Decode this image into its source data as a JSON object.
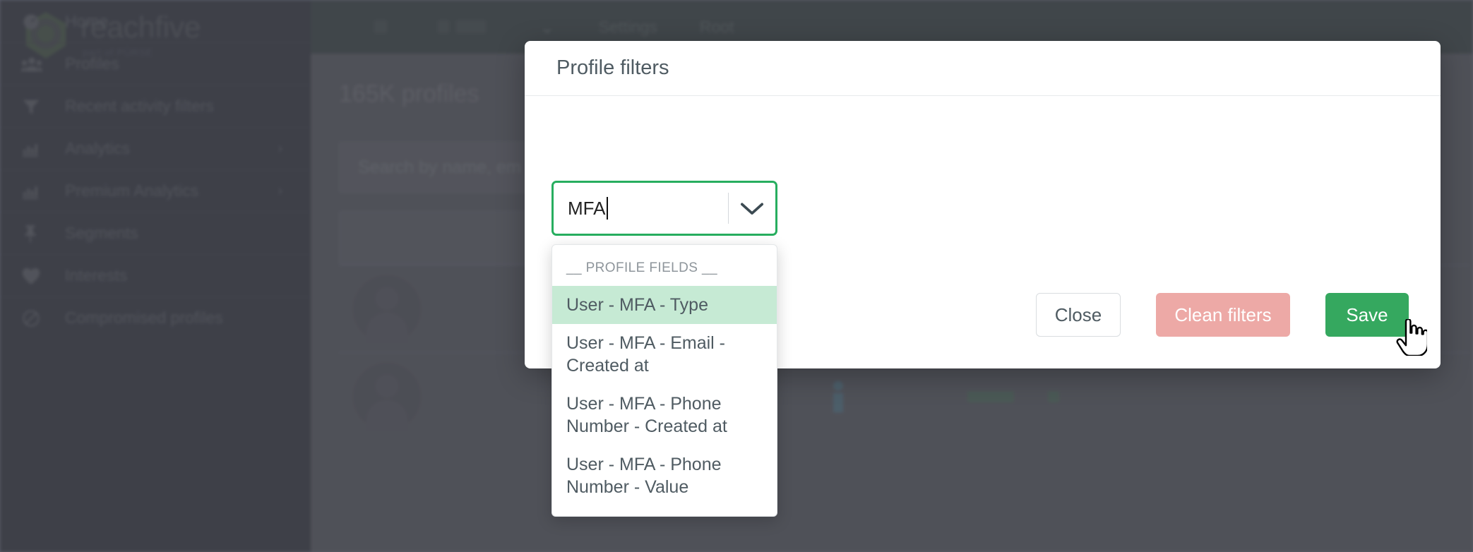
{
  "sidebar": {
    "brand": {
      "name": "reachfive",
      "tagline": "part of PÜRSE",
      "logo_icon": "hexagon-ring-logo"
    },
    "items": [
      {
        "label": "Home",
        "icon": "gauge-icon",
        "has_chevron": false
      },
      {
        "label": "Profiles",
        "icon": "people-icon",
        "has_chevron": false
      },
      {
        "label": "Recent activity filters",
        "icon": "funnel-icon",
        "has_chevron": false
      },
      {
        "label": "Analytics",
        "icon": "bar-chart-icon",
        "has_chevron": true,
        "chevron": "›"
      },
      {
        "label": "Premium Analytics",
        "icon": "bar-chart-icon",
        "has_chevron": true,
        "chevron": "›"
      },
      {
        "label": "Segments",
        "icon": "pin-icon",
        "has_chevron": false
      },
      {
        "label": "Interests",
        "icon": "heart-icon",
        "has_chevron": false
      },
      {
        "label": "Compromised profiles",
        "icon": "ban-icon",
        "has_chevron": false
      }
    ]
  },
  "topbar": {
    "chevron": "⌄",
    "settings_label": "Settings",
    "root_label": "Root"
  },
  "main": {
    "page_title": "165K profiles",
    "search_placeholder": "Search by name, em"
  },
  "modal": {
    "title": "Profile filters",
    "field": {
      "value": "MFA",
      "arrow_icon": "chevron-down-icon"
    },
    "dropdown": {
      "group_label": "__ PROFILE FIELDS __",
      "options": [
        {
          "label": "User - MFA - Type",
          "active": true
        },
        {
          "label": "User - MFA - Email - Created at",
          "active": false
        },
        {
          "label": "User - MFA - Phone Number - Created at",
          "active": false
        },
        {
          "label": "User - MFA - Phone Number - Value",
          "active": false
        }
      ]
    },
    "actions": {
      "close_label": "Close",
      "clean_label": "Clean filters",
      "save_label": "Save"
    }
  },
  "colors": {
    "accent_green": "#35a85f",
    "field_border_green": "#27ae5f",
    "option_highlight": "#c6ead4",
    "danger_pink": "#eda9a6",
    "sidebar_bg": "#464a5a",
    "topbar_bg": "#47525a",
    "content_bg": "#5b5e6c"
  },
  "cursor": {
    "icon": "pointer-hand-cursor"
  }
}
